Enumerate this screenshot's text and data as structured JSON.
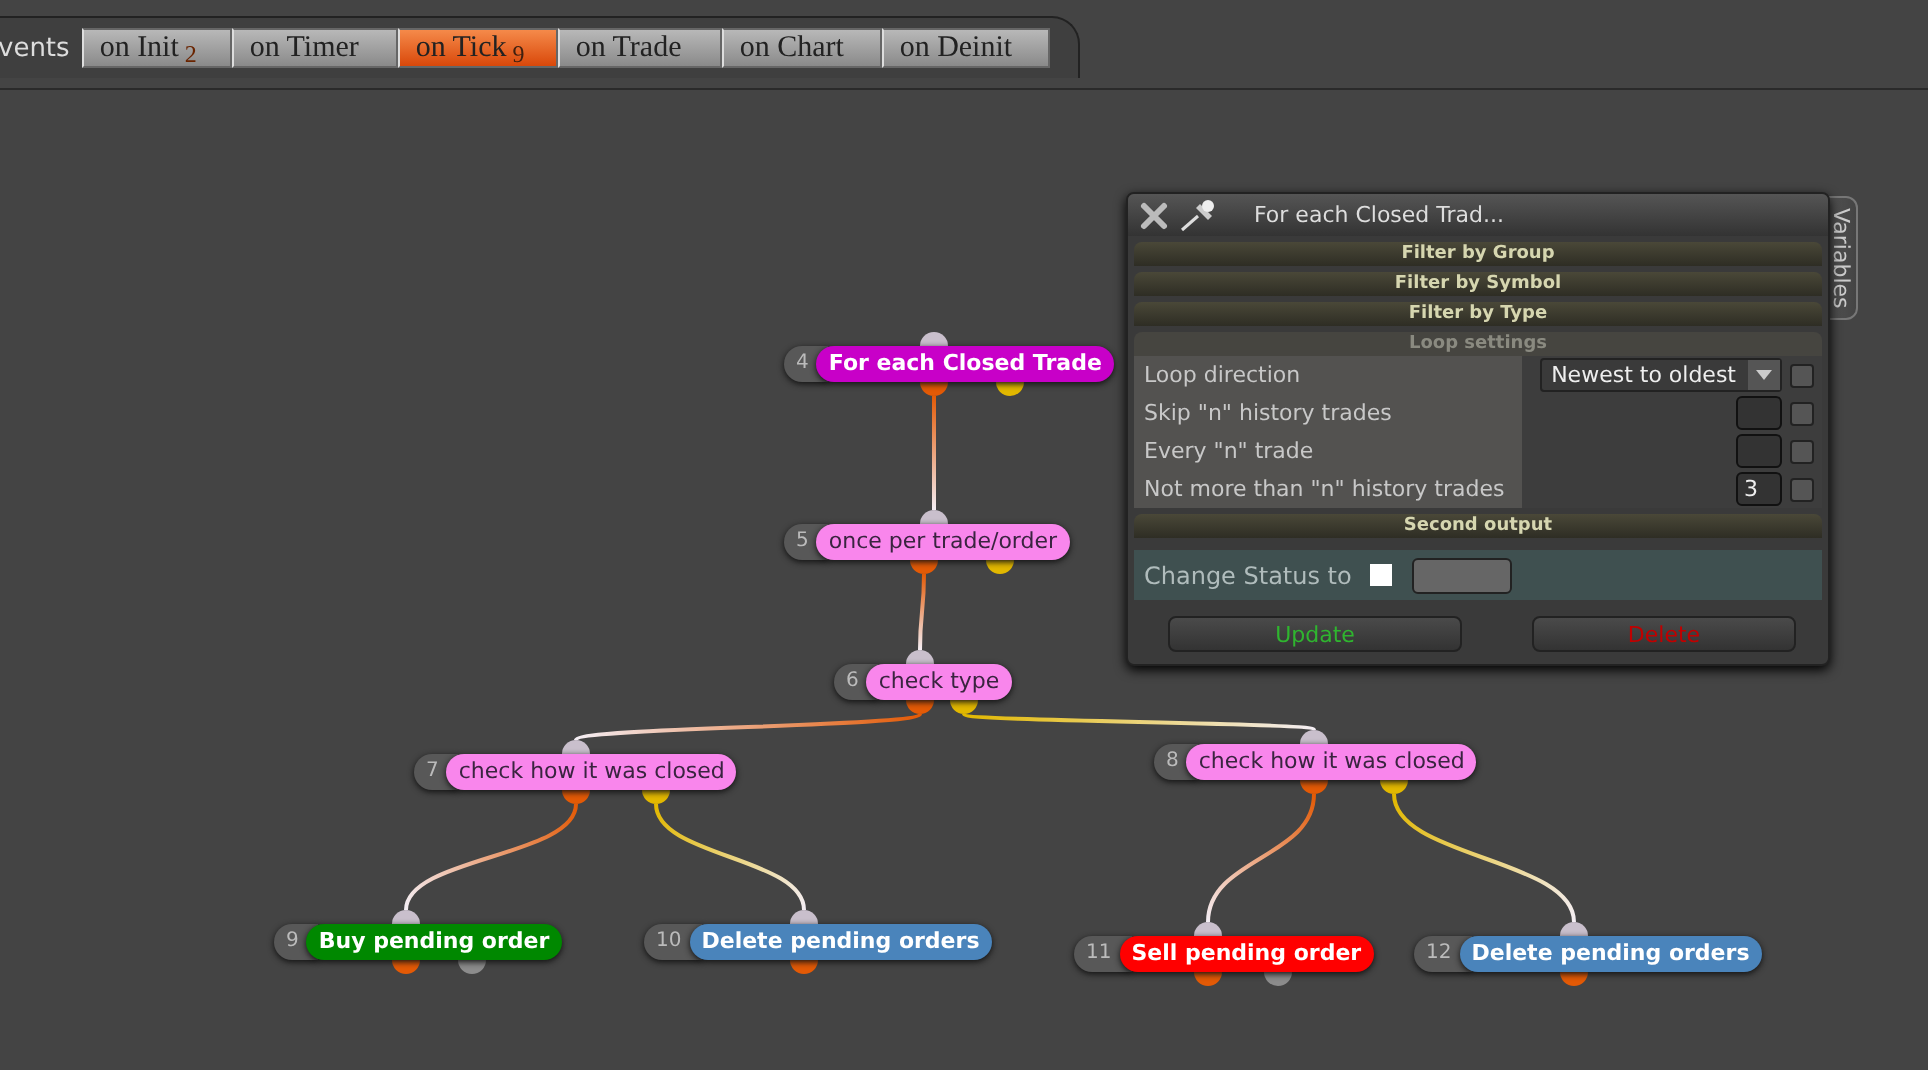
{
  "events": {
    "label": "vents",
    "tabs": [
      {
        "label": "on Init",
        "count": "2",
        "selected": false
      },
      {
        "label": "on Timer",
        "selected": false
      },
      {
        "label": "on Tick",
        "count": "9",
        "selected": true
      },
      {
        "label": "on Trade",
        "selected": false
      },
      {
        "label": "on Chart",
        "selected": false
      },
      {
        "label": "on Deinit",
        "selected": false
      }
    ]
  },
  "nodes": [
    {
      "number": "4",
      "label": "For each Closed Trade",
      "color": "#c800c8",
      "kind": "block"
    },
    {
      "number": "5",
      "label": "once per trade/order",
      "color": "#f986ec",
      "kind": "condition"
    },
    {
      "number": "6",
      "label": "check type",
      "color": "#f986ec",
      "kind": "condition"
    },
    {
      "number": "7",
      "label": "check how it was closed",
      "color": "#f986ec",
      "kind": "condition"
    },
    {
      "number": "8",
      "label": "check how it was closed",
      "color": "#f986ec",
      "kind": "condition"
    },
    {
      "number": "9",
      "label": "Buy pending order",
      "color": "#008800",
      "kind": "block"
    },
    {
      "number": "10",
      "label": "Delete pending orders",
      "color": "#4a84bb",
      "kind": "block"
    },
    {
      "number": "11",
      "label": "Sell pending order",
      "color": "#ff0000",
      "kind": "block"
    },
    {
      "number": "12",
      "label": "Delete pending orders",
      "color": "#4a84bb",
      "kind": "block"
    }
  ],
  "panel": {
    "title": "For each Closed Trad...",
    "side_tab": "Variables",
    "sections": [
      {
        "title": "Filter by Group",
        "expanded": false
      },
      {
        "title": "Filter by Symbol",
        "expanded": false
      },
      {
        "title": "Filter by Type",
        "expanded": false
      },
      {
        "title": "Loop settings",
        "expanded": true,
        "rows": [
          {
            "label": "Loop direction",
            "kind": "dropdown",
            "value": "Newest to oldest",
            "checked": false
          },
          {
            "label": "Skip \"n\" history trades",
            "kind": "number",
            "checked": false
          },
          {
            "label": "Every \"n\" trade",
            "kind": "number",
            "checked": false
          },
          {
            "label": "Not more than \"n\" history trades",
            "kind": "number",
            "value": "3",
            "checked": false
          }
        ]
      },
      {
        "title": "Second output",
        "expanded": false
      }
    ],
    "status": {
      "label": "Change Status to",
      "checked": false
    },
    "buttons": [
      {
        "label": "Update",
        "kind": "update"
      },
      {
        "label": "Delete",
        "kind": "delete"
      }
    ]
  }
}
